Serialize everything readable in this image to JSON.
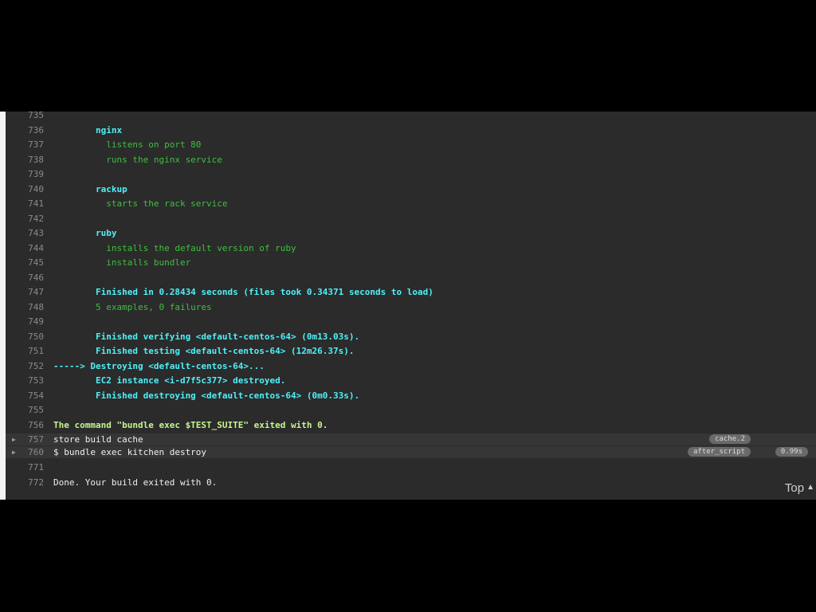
{
  "log": {
    "lines": [
      {
        "num": "735",
        "text": "",
        "color": "green"
      },
      {
        "num": "736",
        "text": "        nginx",
        "color": "cyan"
      },
      {
        "num": "737",
        "text": "          listens on port 80",
        "color": "green"
      },
      {
        "num": "738",
        "text": "          runs the nginx service",
        "color": "green"
      },
      {
        "num": "739",
        "text": "",
        "color": "green"
      },
      {
        "num": "740",
        "text": "        rackup",
        "color": "cyan"
      },
      {
        "num": "741",
        "text": "          starts the rack service",
        "color": "green"
      },
      {
        "num": "742",
        "text": "",
        "color": "green"
      },
      {
        "num": "743",
        "text": "        ruby",
        "color": "cyan"
      },
      {
        "num": "744",
        "text": "          installs the default version of ruby",
        "color": "green"
      },
      {
        "num": "745",
        "text": "          installs bundler",
        "color": "green"
      },
      {
        "num": "746",
        "text": "",
        "color": "green"
      },
      {
        "num": "747",
        "text": "        Finished in 0.28434 seconds (files took 0.34371 seconds to load)",
        "color": "cyan"
      },
      {
        "num": "748",
        "text": "        5 examples, 0 failures",
        "color": "green"
      },
      {
        "num": "749",
        "text": "",
        "color": "green"
      },
      {
        "num": "750",
        "text": "        Finished verifying <default-centos-64> (0m13.03s).",
        "color": "cyan"
      },
      {
        "num": "751",
        "text": "        Finished testing <default-centos-64> (12m26.37s).",
        "color": "cyan"
      },
      {
        "num": "752",
        "text": "-----> Destroying <default-centos-64>...",
        "color": "cyan"
      },
      {
        "num": "753",
        "text": "        EC2 instance <i-d7f5c377> destroyed.",
        "color": "cyan"
      },
      {
        "num": "754",
        "text": "        Finished destroying <default-centos-64> (0m0.33s).",
        "color": "cyan"
      },
      {
        "num": "755",
        "text": "",
        "color": "green"
      },
      {
        "num": "756",
        "text": "The command \"bundle exec $TEST_SUITE\" exited with 0.",
        "color": "lgreen"
      }
    ],
    "folds": [
      {
        "num": "757",
        "text": "store build cache",
        "badge": "cache.2",
        "time": ""
      },
      {
        "num": "760",
        "text": "$ bundle exec kitchen destroy",
        "badge": "after_script",
        "time": "0.99s"
      }
    ],
    "tail": [
      {
        "num": "771",
        "text": ""
      },
      {
        "num": "772",
        "text": "Done. Your build exited with 0."
      }
    ],
    "fold_arrow": "▶"
  },
  "top_link": {
    "label": "Top",
    "caret": "▲"
  }
}
